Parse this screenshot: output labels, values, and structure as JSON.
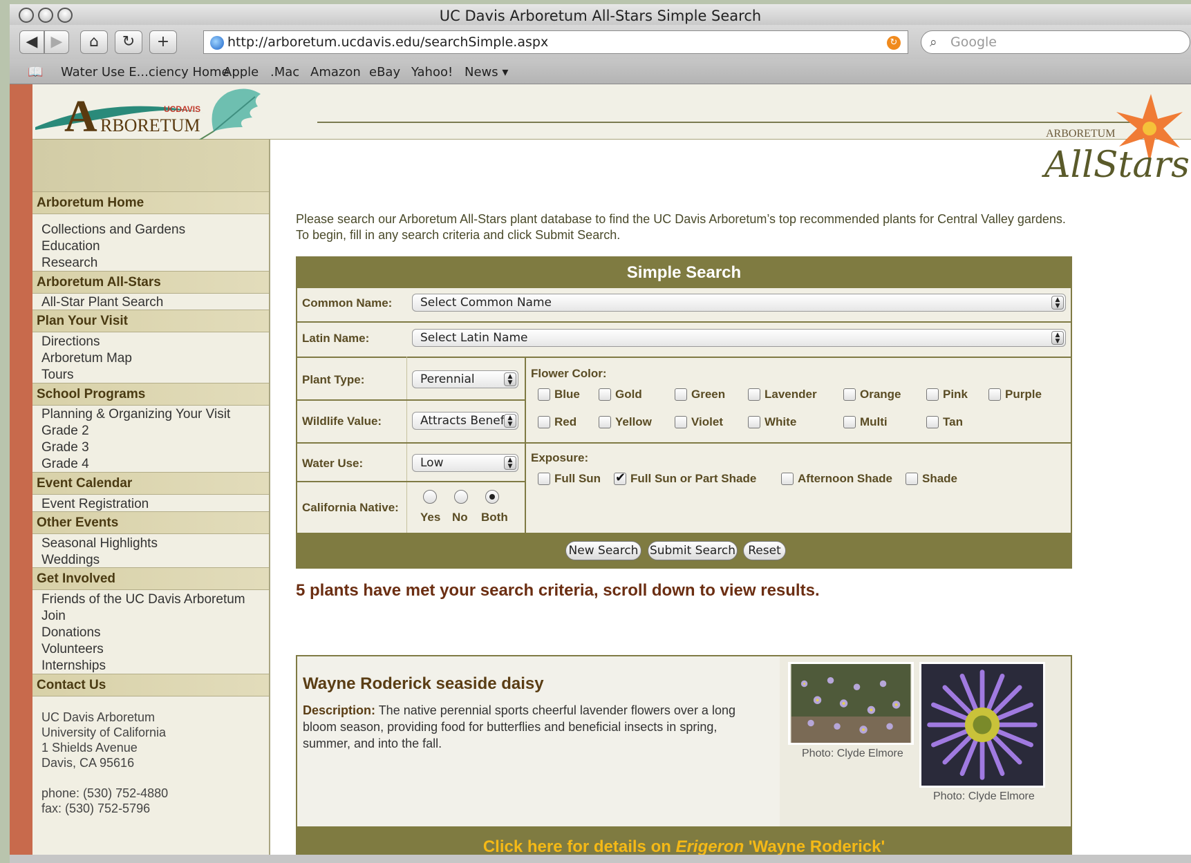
{
  "window": {
    "title": "UC Davis Arboretum All-Stars Simple Search"
  },
  "toolbar": {
    "url": "http://arboretum.ucdavis.edu/searchSimple.aspx",
    "search_placeholder": "Google"
  },
  "bookmarks": [
    "Water Use E...ciency Home",
    "Apple",
    ".Mac",
    "Amazon",
    "eBay",
    "Yahoo!",
    "News ▾"
  ],
  "header": {
    "logo_small": "UCDAVIS",
    "logo_a": "A",
    "logo_rest": "RBORETUM",
    "badge_top": "ARBORETUM",
    "badge_script": "AllStars"
  },
  "sidebar": {
    "sections": [
      {
        "head": "Arboretum Home",
        "items": [
          "Collections and Gardens",
          "Education",
          "Research"
        ]
      },
      {
        "head": "Arboretum All-Stars",
        "items": [
          "All-Star Plant Search"
        ]
      },
      {
        "head": "Plan Your Visit",
        "items": [
          "Directions",
          "Arboretum Map",
          "Tours"
        ]
      },
      {
        "head": "School Programs",
        "items": [
          "Planning & Organizing Your Visit",
          "Grade 2",
          "Grade 3",
          "Grade 4"
        ]
      },
      {
        "head": "Event Calendar",
        "items": [
          "Event Registration"
        ]
      },
      {
        "head": "Other Events",
        "items": [
          "Seasonal Highlights",
          "Weddings"
        ]
      },
      {
        "head": "Get Involved",
        "items": [
          "Friends of the UC Davis Arboretum",
          "Join",
          "Donations",
          "Volunteers",
          "Internships"
        ]
      },
      {
        "head": "Contact Us",
        "items": []
      }
    ],
    "address": [
      "UC Davis Arboretum",
      "University of California",
      "1 Shields Avenue",
      "Davis, CA 95616"
    ],
    "phone": "phone: (530) 752-4880",
    "fax": "fax: (530) 752-5796"
  },
  "intro": {
    "line1": "Please search our Arboretum All-Stars plant database to find the UC Davis Arboretum’s top recommended plants for Central Valley gardens.",
    "line2": "To begin, fill in any search criteria and click Submit Search."
  },
  "form": {
    "title": "Simple Search",
    "common_name_label": "Common Name:",
    "common_name_value": "Select Common Name",
    "latin_name_label": "Latin Name:",
    "latin_name_value": "Select Latin Name",
    "plant_type_label": "Plant Type:",
    "plant_type_value": "Perennial",
    "wildlife_label": "Wildlife Value:",
    "wildlife_value": "Attracts Beneficial Insects",
    "water_label": "Water Use:",
    "water_value": "Low",
    "native_label": "California Native:",
    "native_options": [
      "Yes",
      "No",
      "Both"
    ],
    "native_selected": "Both",
    "flower_color_label": "Flower Color:",
    "flower_colors": [
      "Blue",
      "Gold",
      "Green",
      "Lavender",
      "Orange",
      "Pink",
      "Purple",
      "Red",
      "Yellow",
      "Violet",
      "White",
      "Multi",
      "Tan"
    ],
    "exposure_label": "Exposure:",
    "exposures": [
      "Full Sun",
      "Full Sun or Part Shade",
      "Afternoon Shade",
      "Shade"
    ],
    "exposure_checked": "Full Sun or Part Shade",
    "buttons": {
      "new": "New Search",
      "submit": "Submit Search",
      "reset": "Reset"
    }
  },
  "results": {
    "message": "5 plants have met your search criteria, scroll down to view results.",
    "item": {
      "name": "Wayne Roderick seaside daisy",
      "desc_label": "Description:",
      "desc": " The native perennial sports cheerful lavender flowers over a long bloom season, providing food for butterflies and beneficial insects in spring, summer, and into the fall.",
      "caption1": "Photo: Clyde Elmore",
      "caption2": "Photo: Clyde Elmore",
      "link_pre": "Click here for details on ",
      "link_genus": "Erigeron",
      "link_post": " 'Wayne Roderick'"
    }
  },
  "colors": {
    "olive": "#7f7b41",
    "stripe": "#c86a4c",
    "accent": "#f5b916"
  }
}
